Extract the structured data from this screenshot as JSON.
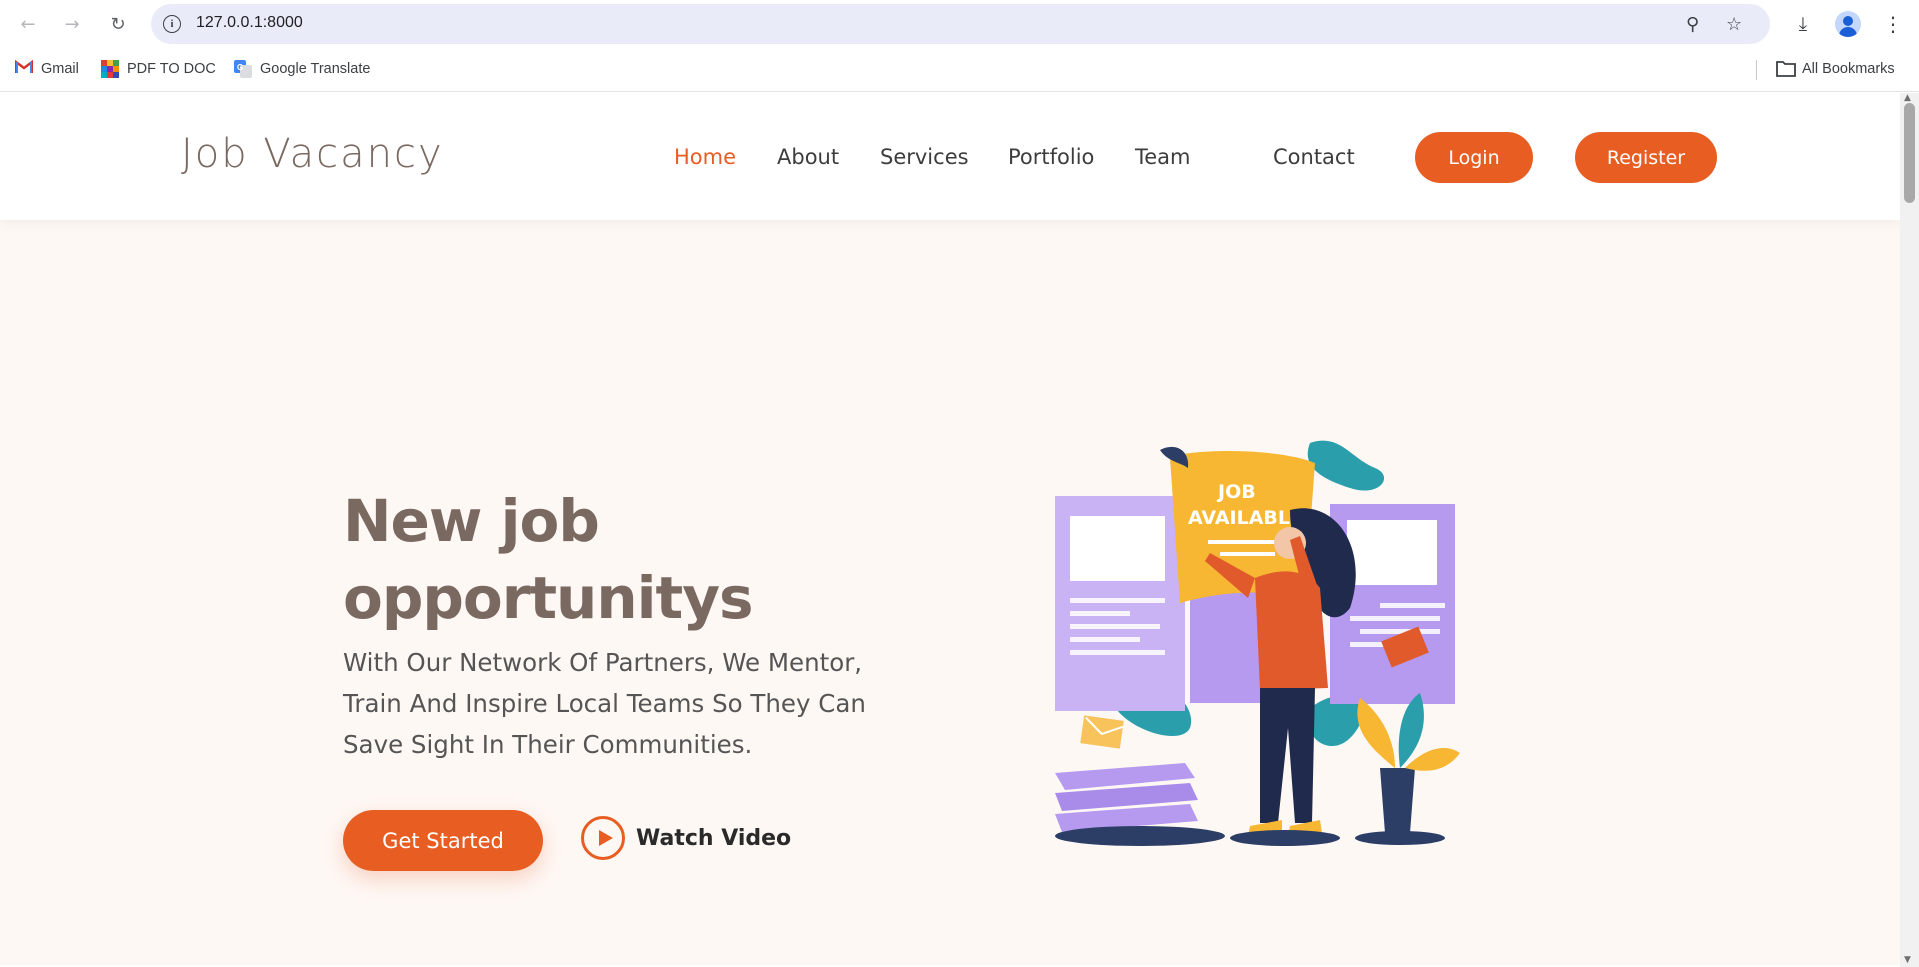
{
  "browser": {
    "url": "127.0.0.1:8000",
    "bookmarks": [
      {
        "label": "Gmail",
        "icon": "gmail-icon"
      },
      {
        "label": "PDF TO DOC",
        "icon": "pdf-to-doc-icon"
      },
      {
        "label": "Google Translate",
        "icon": "google-translate-icon"
      }
    ],
    "all_bookmarks_label": "All Bookmarks"
  },
  "site": {
    "logo": "Job Vacancy",
    "nav": [
      "Home",
      "About",
      "Services",
      "Portfolio",
      "Team",
      "Contact"
    ],
    "active_nav": "Home",
    "login_label": "Login",
    "register_label": "Register"
  },
  "hero": {
    "title": "New job opportunitys",
    "subtitle": "With Our Network Of Partners, We Mentor, Train And Inspire Local Teams So They Can Save Sight In Their Communities.",
    "primary_cta": "Get Started",
    "secondary_cta": "Watch Video",
    "illustration_text": "JOB AVAILABLE"
  },
  "colors": {
    "accent": "#e85d22",
    "heading": "#7a6961",
    "hero_bg": "#fef8f5"
  }
}
